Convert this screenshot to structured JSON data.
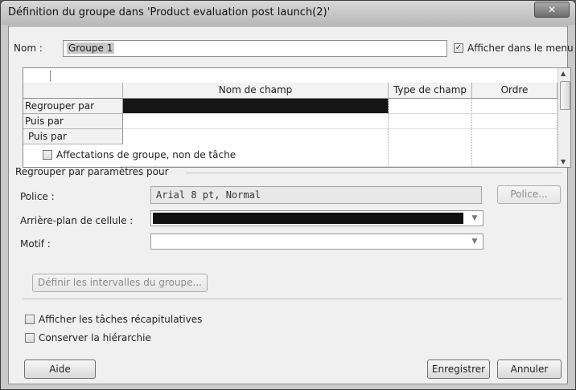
{
  "window": {
    "title": "Définition du groupe dans 'Product evaluation post launch(2)'",
    "close_glyph": "✕"
  },
  "name_row": {
    "label": "Nom :",
    "value": "Groupe 1",
    "show_in_menu": {
      "label": "Afficher dans le menu",
      "checked": true
    }
  },
  "grid": {
    "columns": [
      "Nom de champ",
      "Type de champ",
      "Ordre"
    ],
    "rows": [
      {
        "label": "Regrouper par",
        "selected": true
      },
      {
        "label": "Puis par",
        "selected": false
      },
      {
        "label": "Puis par",
        "selected": false
      }
    ]
  },
  "assignment_groups": {
    "label": "Affectations de groupe, non de tâche",
    "checked": false
  },
  "settings": {
    "section_label": "Regrouper par paramètres pour",
    "font": {
      "label": "Police :",
      "value": "Arial 8 pt, Normal",
      "button": "Police..."
    },
    "cell_background": {
      "label": "Arrière-plan de cellule :",
      "value_color": "#111111"
    },
    "pattern": {
      "label": "Motif :",
      "value": ""
    },
    "intervals_button": "Définir les intervalles du groupe..."
  },
  "options": {
    "show_summary": {
      "label": "Afficher les tâches récapitulatives",
      "checked": false
    },
    "keep_hierarchy": {
      "label": "Conserver la hiérarchie",
      "checked": false
    }
  },
  "buttons": {
    "help": "Aide",
    "save": "Enregistrer",
    "cancel": "Annuler"
  },
  "icons": {
    "check": "✓",
    "dropdown": "▼",
    "scroll_up": "▲",
    "scroll_down": "▼"
  }
}
